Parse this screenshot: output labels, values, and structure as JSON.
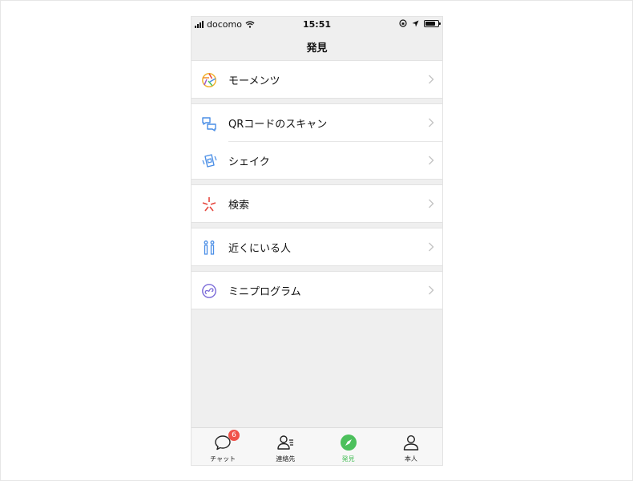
{
  "status_bar": {
    "carrier": "docomo",
    "time": "15:51"
  },
  "nav": {
    "title": "発見"
  },
  "menu": {
    "moments": "モーメンツ",
    "qr_scan": "QRコードのスキャン",
    "shake": "シェイク",
    "search": "検索",
    "nearby": "近くにいる人",
    "mini_programs": "ミニプログラム"
  },
  "tabbar": {
    "chats": "チャット",
    "chats_badge": "6",
    "contacts": "連絡先",
    "discover": "発見",
    "me": "本人"
  },
  "colors": {
    "accent_green": "#4cc05c",
    "badge_red": "#f0524a",
    "icon_blue": "#4a8ee6",
    "search_red": "#e6453c",
    "mini_purple": "#7b6bd8"
  }
}
